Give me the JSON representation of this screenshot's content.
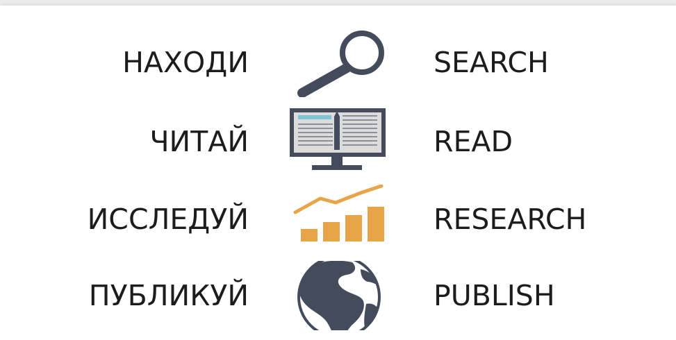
{
  "rows": [
    {
      "ru": "НАХОДИ",
      "en": "SEARCH",
      "icon": "magnifier-icon"
    },
    {
      "ru": "ЧИТАЙ",
      "en": "READ",
      "icon": "monitor-book-icon"
    },
    {
      "ru": "ИССЛЕДУЙ",
      "en": "RESEARCH",
      "icon": "growth-chart-icon"
    },
    {
      "ru": "ПУБЛИКУЙ",
      "en": "PUBLISH",
      "icon": "globe-icon"
    }
  ],
  "colors": {
    "dark": "#444c5b",
    "accent_blue": "#7cc4d6",
    "accent_orange": "#e8a548",
    "screen": "#dcdcdc",
    "text": "#1c1c1c"
  }
}
